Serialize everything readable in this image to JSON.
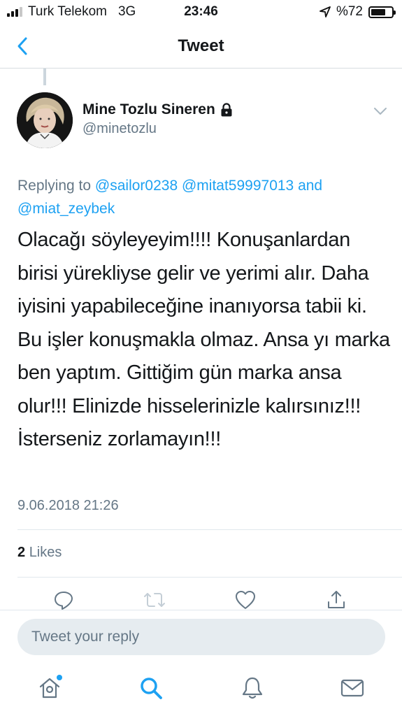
{
  "status_bar": {
    "carrier": "Turk Telekom",
    "network": "3G",
    "time": "23:46",
    "battery_text": "%72",
    "battery_level": 0.72
  },
  "nav": {
    "title": "Tweet",
    "back_icon": "chevron-left-icon",
    "accent_color": "#1da1f2"
  },
  "tweet": {
    "author_name": "Mine Tozlu Sineren",
    "author_handle": "@minetozlu",
    "protected_icon": "lock-icon",
    "replying_prefix": "Replying to",
    "mention_1": "@sailor0238",
    "mention_2": "@mitat59997013",
    "replying_and": "and",
    "mention_3": "@miat_zeybek",
    "text": "Olacağı söyleyeyim!!!! Konuşanlardan birisi yürekliyse gelir ve yerimi alır. Daha iyisini yapabileceğine inanıyorsa tabii ki. Bu işler konuşmakla olmaz. Ansa yı marka ben yaptım. Gittiğim gün marka ansa olur!!! Elinizde hisselerinizle kalırsınız!!! İsterseniz zorlamayın!!!",
    "timestamp": "9.06.2018 21:26",
    "likes_count": "2",
    "likes_label": "Likes"
  },
  "actions": [
    "reply-icon",
    "retweet-icon",
    "like-icon",
    "share-icon"
  ],
  "reply_box": {
    "placeholder": "Tweet your reply"
  },
  "tab_bar": [
    "home-icon",
    "search-icon",
    "notifications-icon",
    "messages-icon"
  ],
  "colors": {
    "secondary_text": "#657786",
    "mention": "#1da1f2",
    "divider": "#e1e8ed",
    "input_bg": "#e6ecf0"
  }
}
